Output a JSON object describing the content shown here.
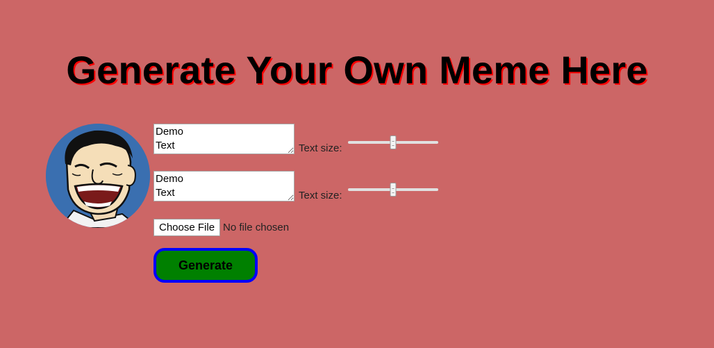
{
  "page": {
    "title": "Generate Your Own Meme Here",
    "background_color": "#cc6666",
    "title_shadow_color": "#ff0000"
  },
  "avatar": {
    "icon": "laughing-face-meme-icon"
  },
  "text_fields": [
    {
      "value": "Demo\nText",
      "size_label": "Text size:",
      "slider_value": 0.5
    },
    {
      "value": "Demo\nText",
      "size_label": "Text size:",
      "slider_value": 0.5
    }
  ],
  "file_input": {
    "button_label": "Choose File",
    "status": "No file chosen"
  },
  "generate_button": {
    "label": "Generate",
    "background": "#008000",
    "border": "#0000ff"
  }
}
